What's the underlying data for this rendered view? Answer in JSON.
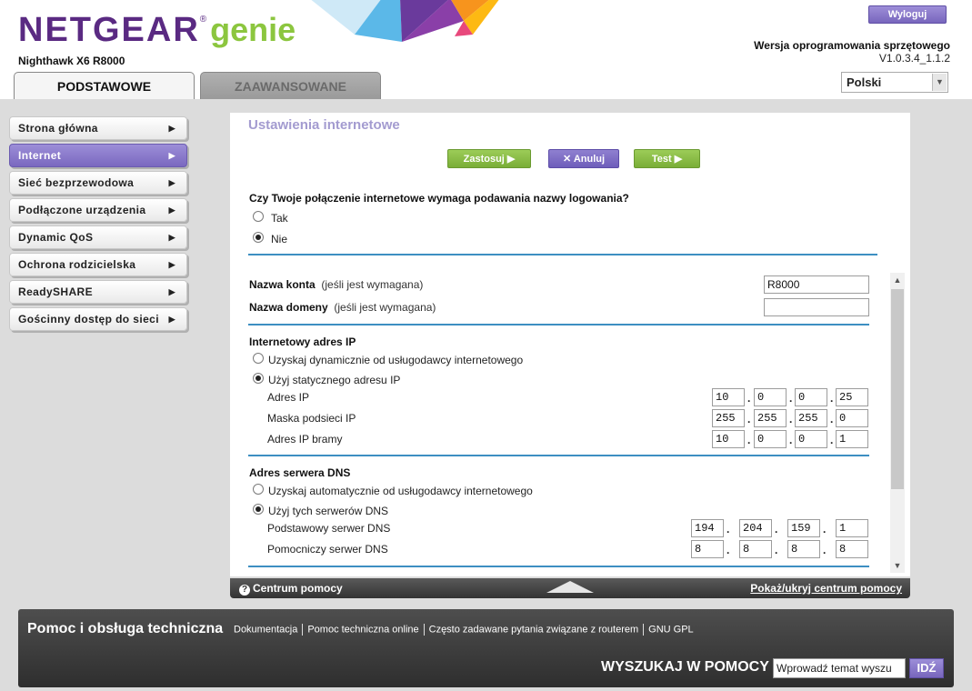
{
  "brand": {
    "name": "NETGEAR",
    "reg": "®",
    "product": "genie",
    "model": "Nighthawk X6 R8000"
  },
  "header": {
    "logout_label": "Wyloguj",
    "firmware_label": "Wersja oprogramowania sprzętowego",
    "firmware_version": "V1.0.3.4_1.1.2",
    "language": "Polski",
    "tabs": [
      {
        "label": "PODSTAWOWE",
        "active": true
      },
      {
        "label": "ZAAWANSOWANE",
        "active": false
      }
    ]
  },
  "sidebar": {
    "items": [
      {
        "label": "Strona główna",
        "active": false
      },
      {
        "label": "Internet",
        "active": true
      },
      {
        "label": "Sieć bezprzewodowa",
        "active": false
      },
      {
        "label": "Podłączone urządzenia",
        "active": false
      },
      {
        "label": "Dynamic QoS",
        "active": false
      },
      {
        "label": "Ochrona rodzicielska",
        "active": false
      },
      {
        "label": "ReadySHARE",
        "active": false
      },
      {
        "label": "Gościnny dostęp do sieci",
        "active": false
      }
    ]
  },
  "main": {
    "title": "Ustawienia internetowe",
    "buttons": {
      "apply": "Zastosuj",
      "cancel": "Anuluj",
      "test": "Test"
    },
    "login_question": "Czy Twoje połączenie internetowe wymaga podawania nazwy logowania?",
    "login_options": {
      "yes": "Tak",
      "no": "Nie",
      "selected": "no"
    },
    "account": {
      "account_name_label": "Nazwa konta",
      "domain_name_label": "Nazwa domeny",
      "optional_note": "(jeśli jest wymagana)",
      "account_name_value": "R8000",
      "domain_name_value": ""
    },
    "ip": {
      "section_title": "Internetowy adres IP",
      "option_dynamic": "Uzyskaj dynamicznie od usługodawcy internetowego",
      "option_static": "Użyj statycznego adresu IP",
      "selected": "static",
      "ip_label": "Adres IP",
      "mask_label": "Maska podsieci IP",
      "gateway_label": "Adres IP bramy",
      "ip_octets": [
        "10",
        "0",
        "0",
        "25"
      ],
      "mask_octets": [
        "255",
        "255",
        "255",
        "0"
      ],
      "gateway_octets": [
        "10",
        "0",
        "0",
        "1"
      ]
    },
    "dns": {
      "section_title": "Adres serwera DNS",
      "option_auto": "Uzyskaj automatycznie od usługodawcy internetowego",
      "option_manual": "Użyj tych serwerów DNS",
      "selected": "manual",
      "primary_label": "Podstawowy serwer DNS",
      "secondary_label": "Pomocniczy serwer DNS",
      "primary_octets": [
        "194",
        "204",
        "159",
        "1"
      ],
      "secondary_octets": [
        "8",
        "8",
        "8",
        "8"
      ]
    }
  },
  "helpbar": {
    "center_label": "Centrum pomocy",
    "toggle_label": "Pokaż/ukryj centrum pomocy"
  },
  "footer": {
    "title": "Pomoc i obsługa techniczna",
    "links": [
      "Dokumentacja",
      "Pomoc techniczna online",
      "Często zadawane pytania związane z routerem",
      "GNU GPL"
    ],
    "search_label": "WYSZUKAJ W POMOCY",
    "search_value": "Wprowadź temat wyszu",
    "go_label": "IDŹ"
  },
  "colors": {
    "purple": "#5a2a82",
    "genie_green": "#8cc63f",
    "active_nav": "#8a7acb",
    "divider": "#3d8fc2",
    "title": "#a39bd0"
  }
}
